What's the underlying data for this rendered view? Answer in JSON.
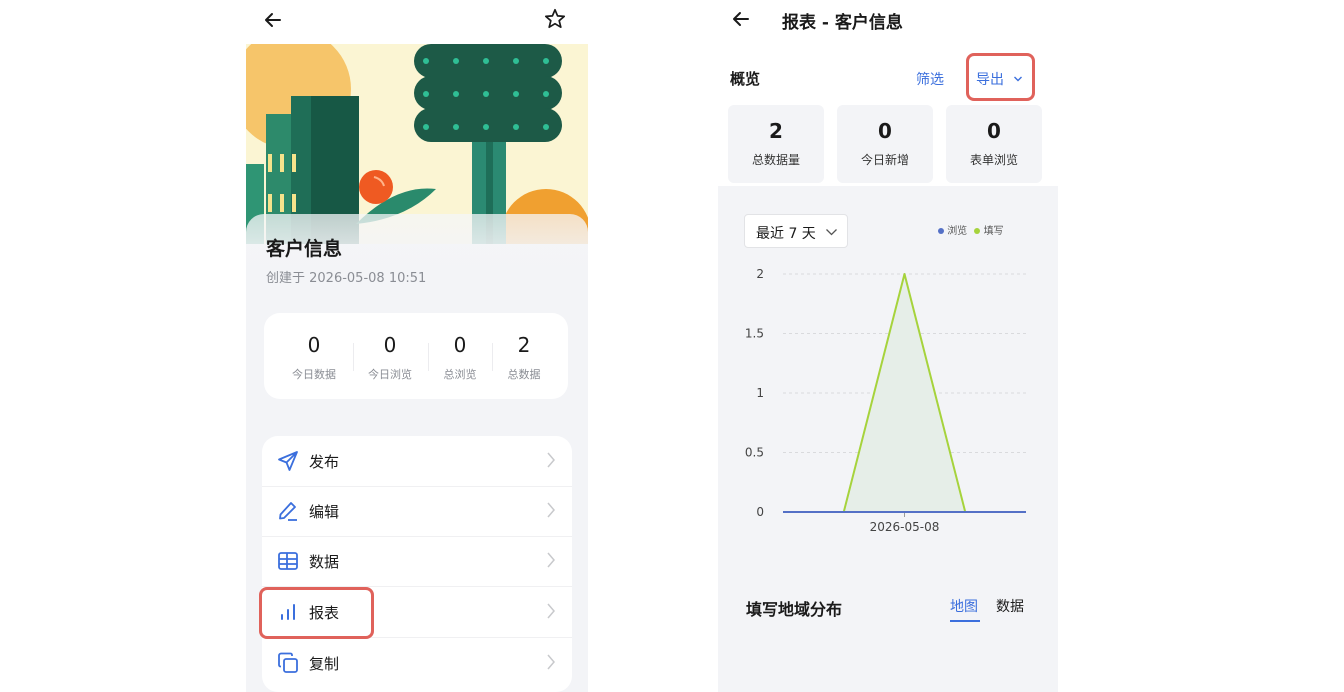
{
  "left_screen": {
    "title": "客户信息",
    "created": "创建于 2026-05-08 10:51",
    "stats": [
      {
        "value": "0",
        "label": "今日数据"
      },
      {
        "value": "0",
        "label": "今日浏览"
      },
      {
        "value": "0",
        "label": "总浏览"
      },
      {
        "value": "2",
        "label": "总数据"
      }
    ],
    "menu": [
      {
        "label": "发布",
        "icon": "send-icon"
      },
      {
        "label": "编辑",
        "icon": "pen-icon"
      },
      {
        "label": "数据",
        "icon": "table-icon"
      },
      {
        "label": "报表",
        "icon": "bar-chart-icon"
      },
      {
        "label": "复制",
        "icon": "copy-icon"
      }
    ],
    "highlight_color": "#e0625b"
  },
  "right_screen": {
    "header_title": "报表 - 客户信息",
    "overview_label": "概览",
    "filter_label": "筛选",
    "export_label": "导出",
    "overview": [
      {
        "value": "2",
        "label": "总数据量"
      },
      {
        "value": "0",
        "label": "今日新增"
      },
      {
        "value": "0",
        "label": "表单浏览"
      }
    ],
    "range_label": "最近 7 天",
    "region_title": "填写地域分布",
    "tabs": [
      "地图",
      "数据"
    ],
    "accent_color": "#3b6fdd"
  },
  "chart_data": {
    "type": "line",
    "x": [
      "",
      "",
      "2026-05-08",
      "",
      ""
    ],
    "x_tick_label": "2026-05-08",
    "series": [
      {
        "name": "浏览",
        "color": "#5470c6",
        "values": [
          0,
          0,
          0,
          0,
          0
        ]
      },
      {
        "name": "填写",
        "color": "#a6d33c",
        "values": [
          0,
          0,
          2,
          0,
          0
        ]
      }
    ],
    "y_ticks": [
      "2",
      "1.5",
      "1",
      "0.5",
      "0"
    ],
    "ylim": [
      0,
      2
    ],
    "grid": true,
    "legend": "top-right"
  }
}
